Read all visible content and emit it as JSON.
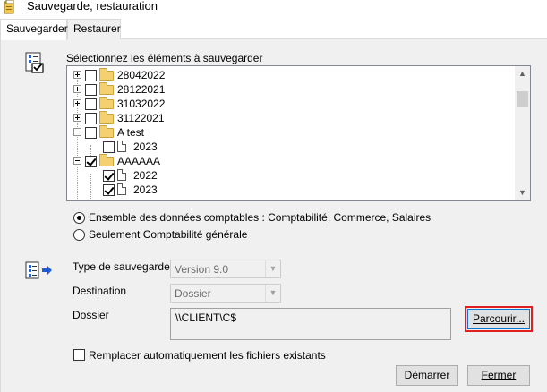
{
  "window": {
    "title": "Sauvegarde, restauration",
    "icon": "app-icon"
  },
  "tabs": [
    {
      "label": "Sauvegarder",
      "active": true
    },
    {
      "label": "Restaurer",
      "active": false
    }
  ],
  "select_section": {
    "heading": "Sélectionnez les éléments à sauvegarder",
    "icon": "checklist-icon"
  },
  "tree": {
    "items": [
      {
        "label": "28042022",
        "type": "folder",
        "expander": "plus",
        "checked": false,
        "level": 0
      },
      {
        "label": "28122021",
        "type": "folder",
        "expander": "plus",
        "checked": false,
        "level": 0
      },
      {
        "label": "31032022",
        "type": "folder",
        "expander": "plus",
        "checked": false,
        "level": 0
      },
      {
        "label": "31122021",
        "type": "folder",
        "expander": "plus",
        "checked": false,
        "level": 0
      },
      {
        "label": "A test",
        "type": "folder",
        "expander": "minus",
        "checked": false,
        "level": 0
      },
      {
        "label": "2023",
        "type": "document",
        "expander": "",
        "checked": false,
        "level": 1
      },
      {
        "label": "AAAAAA",
        "type": "folder",
        "expander": "minus",
        "checked": true,
        "level": 0
      },
      {
        "label": "2022",
        "type": "document",
        "expander": "",
        "checked": true,
        "level": 1
      },
      {
        "label": "2023",
        "type": "document",
        "expander": "",
        "checked": true,
        "level": 1
      }
    ]
  },
  "scope": {
    "option_all": "Ensemble des données comptables : Comptabilité, Commerce, Salaires",
    "option_general": "Seulement Comptabilité générale",
    "selected": "option_all"
  },
  "backup": {
    "icon": "backup-document-icon",
    "type_label": "Type de sauvegarde",
    "type_value": "Version 9.0",
    "destination_label": "Destination",
    "destination_value": "Dossier",
    "folder_label": "Dossier",
    "folder_value": "\\\\CLIENT\\C$",
    "browse_label": "Parcourir...",
    "replace_label": "Remplacer automatiquement les fichiers existants",
    "replace_checked": false
  },
  "footer": {
    "start_label": "Démarrer",
    "close_label": "Fermer"
  }
}
